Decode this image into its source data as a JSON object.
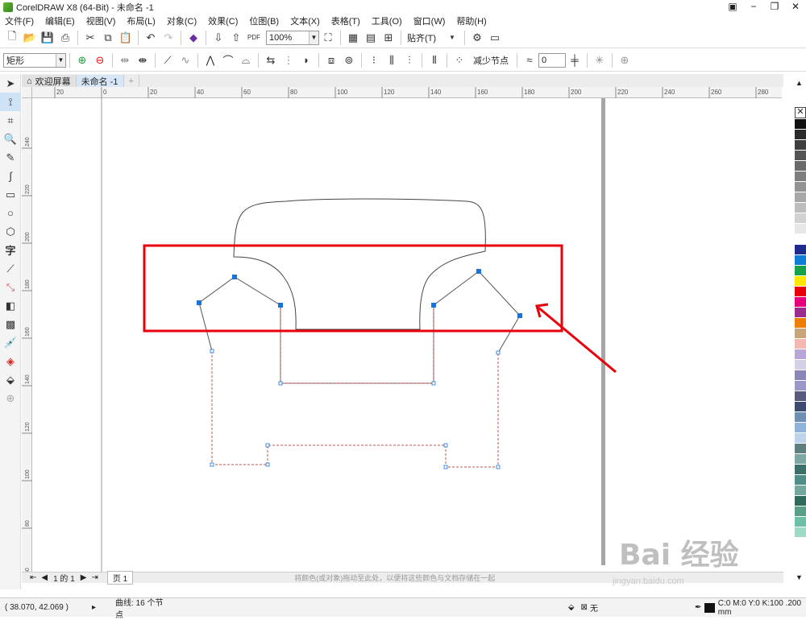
{
  "app": {
    "title": "CorelDRAW X8 (64-Bit) - 未命名 -1"
  },
  "menu": [
    "文件(F)",
    "编辑(E)",
    "视图(V)",
    "布局(L)",
    "对象(C)",
    "效果(C)",
    "位图(B)",
    "文本(X)",
    "表格(T)",
    "工具(O)",
    "窗口(W)",
    "帮助(H)"
  ],
  "toolbar": {
    "zoom": "100%",
    "snap_label": "贴齐(T)"
  },
  "propbar": {
    "object_type": "矩形",
    "reduce_nodes": "减少节点",
    "smooth_value": "0"
  },
  "tabs": {
    "welcome": "欢迎屏幕",
    "doc": "未命名 -1"
  },
  "hruler": [
    "20",
    "0",
    "20",
    "40",
    "60",
    "80",
    "100",
    "120",
    "140",
    "160",
    "180",
    "200",
    "220",
    "240",
    "260",
    "280"
  ],
  "vruler": [
    "240",
    "220",
    "200",
    "180",
    "160",
    "140",
    "120",
    "100",
    "80",
    "60"
  ],
  "pagebar": {
    "page_info": "1 的 1",
    "page_tab": "页 1",
    "hint": "将颜色(或对象)拖动至此处，以便将这些颜色与文档存储在一起"
  },
  "status": {
    "coords": "( 38.070, 42.069 )",
    "node_info": "曲线: 16 个节点",
    "fill": "无",
    "outline": "C:0 M:0 Y:0 K:100  .200 mm"
  },
  "watermark": {
    "brand": "Bai 经验",
    "url": "jingyan.baidu.com"
  },
  "colors": {
    "accent": "#e8000b",
    "node": "#1a73d9",
    "outline_dash": "#c0504d"
  },
  "palette": [
    "#111111",
    "#2b2b2b",
    "#3f3f3f",
    "#545454",
    "#696969",
    "#7e7e7e",
    "#939393",
    "#a8a8a8",
    "#bdbdbd",
    "#d2d2d2",
    "#e7e7e7",
    "#ffffff",
    "#1e2a8c",
    "#0f7ed4",
    "#17a24a",
    "#ffe600",
    "#e8000b",
    "#e6007e",
    "#9b2d8e",
    "#ef7d00",
    "#c8a57a",
    "#f4b8b0",
    "#b7a6d6",
    "#d5cfe8",
    "#8b86b8",
    "#9a98c9",
    "#585a7e",
    "#3c4b6e",
    "#6f8fb5",
    "#8fb3d9",
    "#bcd3ea",
    "#5e7f7d",
    "#7da7a3",
    "#3a6f6a",
    "#4f8f87",
    "#73a89c",
    "#2f6a5a",
    "#5c9f88",
    "#6fbfa8",
    "#9fd9c8"
  ]
}
